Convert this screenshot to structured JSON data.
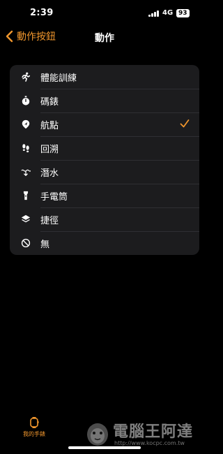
{
  "status": {
    "time": "2:39",
    "network": "4G",
    "battery": "93"
  },
  "nav": {
    "back_label": "動作按鈕",
    "title": "動作"
  },
  "options": [
    {
      "icon": "running-figure-icon",
      "label": "體能訓練",
      "selected": false
    },
    {
      "icon": "stopwatch-icon",
      "label": "碼錶",
      "selected": false
    },
    {
      "icon": "waypoint-icon",
      "label": "航點",
      "selected": true
    },
    {
      "icon": "footprints-icon",
      "label": "回溯",
      "selected": false
    },
    {
      "icon": "dive-icon",
      "label": "潛水",
      "selected": false
    },
    {
      "icon": "flashlight-icon",
      "label": "手電筒",
      "selected": false
    },
    {
      "icon": "shortcuts-icon",
      "label": "捷徑",
      "selected": false
    },
    {
      "icon": "none-icon",
      "label": "無",
      "selected": false
    }
  ],
  "tabbar": {
    "my_watch_label": "我的手錶"
  },
  "watermark": {
    "text": "電腦王阿達",
    "url": "http://www.kocpc.com.tw"
  },
  "colors": {
    "accent": "#f0962d",
    "background": "#000000",
    "card": "#1c1c1e"
  }
}
